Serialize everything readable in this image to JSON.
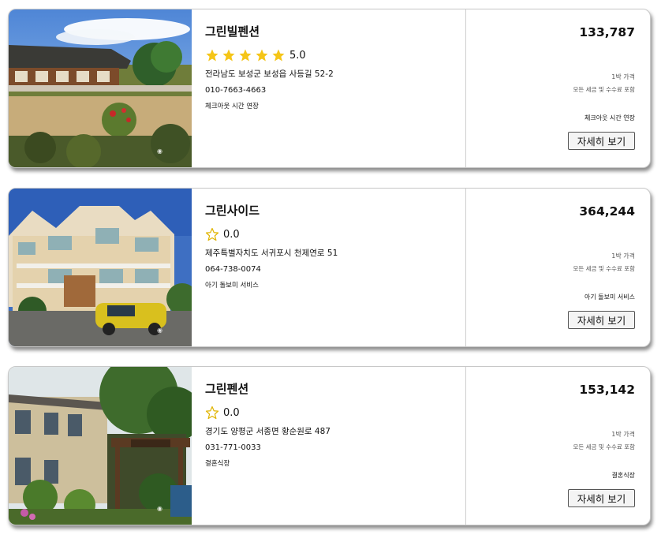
{
  "listings": [
    {
      "name": "그린빌펜션",
      "rating": "5.0",
      "stars_filled": 5,
      "address": "전라남도 보성군 보성읍 사등길 52-2",
      "phone": "010-7663-4663",
      "service": "체크아웃 시간 연장",
      "price": "133,787",
      "per_night_label": "1박 가격",
      "tax_note": "모든 세금 및 수수료 포함",
      "button_label": "자세히 보기",
      "photo_icon": "hanok-house-photo"
    },
    {
      "name": "그린사이드",
      "rating": "0.0",
      "stars_filled": 0,
      "address": "제주특별자치도 서귀포시 천제연로 51",
      "phone": "064-738-0074",
      "service": "아기 돌보미 서비스",
      "price": "364,244",
      "per_night_label": "1박 가격",
      "tax_note": "모든 세금 및 수수료 포함",
      "button_label": "자세히 보기",
      "photo_icon": "villa-building-photo"
    },
    {
      "name": "그린펜션",
      "rating": "0.0",
      "stars_filled": 0,
      "address": "경기도 양평군 서종면 황순원로 487",
      "phone": "031-771-0033",
      "service": "결혼식장",
      "price": "153,142",
      "per_night_label": "1박 가격",
      "tax_note": "모든 세금 및 수수료 포함",
      "button_label": "자세히 보기",
      "photo_icon": "garden-pension-photo"
    }
  ],
  "colors": {
    "star_filled": "#f5c518",
    "star_outline": "#e0b400",
    "card_border": "#c8c8c8"
  }
}
